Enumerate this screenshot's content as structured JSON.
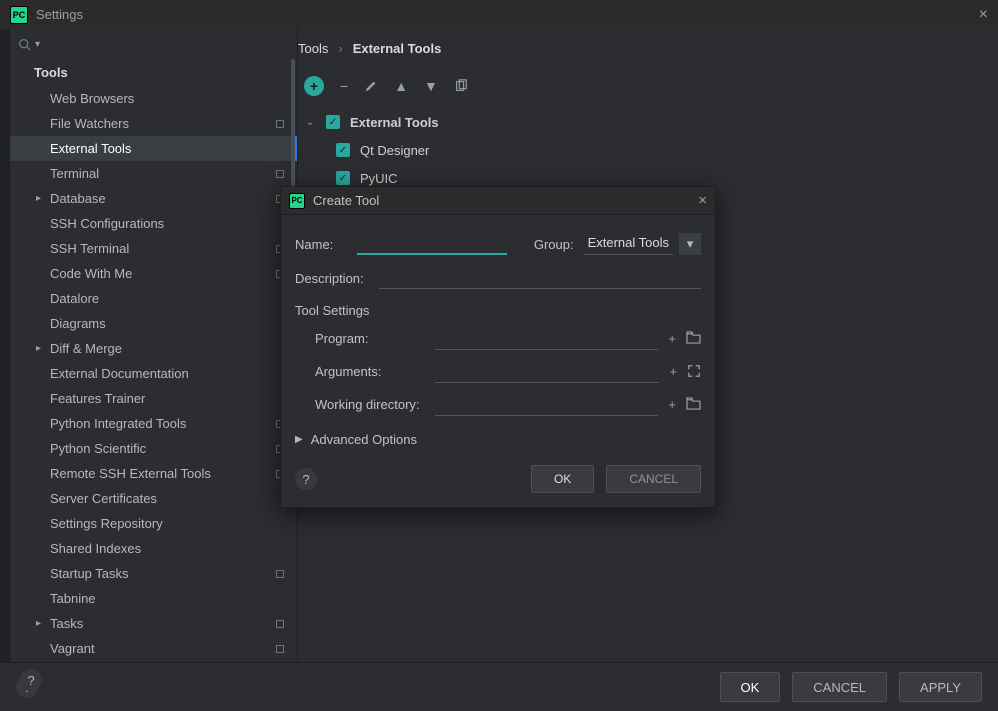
{
  "window": {
    "title": "Settings"
  },
  "search_placeholder": "",
  "sidebar": {
    "header": "Tools",
    "items": [
      {
        "label": "Web Browsers"
      },
      {
        "label": "File Watchers",
        "marker": true
      },
      {
        "label": "External Tools",
        "selected": true
      },
      {
        "label": "Terminal",
        "marker": true
      },
      {
        "label": "Database",
        "chev": true,
        "marker": true
      },
      {
        "label": "SSH Configurations"
      },
      {
        "label": "SSH Terminal",
        "marker": true
      },
      {
        "label": "Code With Me",
        "marker": true
      },
      {
        "label": "Datalore"
      },
      {
        "label": "Diagrams"
      },
      {
        "label": "Diff & Merge",
        "chev": true
      },
      {
        "label": "External Documentation"
      },
      {
        "label": "Features Trainer"
      },
      {
        "label": "Python Integrated Tools",
        "marker": true
      },
      {
        "label": "Python Scientific",
        "marker": true
      },
      {
        "label": "Remote SSH External Tools",
        "marker": true
      },
      {
        "label": "Server Certificates"
      },
      {
        "label": "Settings Repository"
      },
      {
        "label": "Shared Indexes"
      },
      {
        "label": "Startup Tasks",
        "marker": true
      },
      {
        "label": "Tabnine"
      },
      {
        "label": "Tasks",
        "chev": true,
        "marker": true
      },
      {
        "label": "Vagrant",
        "marker": true
      }
    ]
  },
  "breadcrumb": {
    "root": "Tools",
    "sep": "›",
    "leaf": "External Tools"
  },
  "tool_tree": {
    "group": "External Tools",
    "items": [
      "Qt Designer",
      "PyUIC"
    ]
  },
  "modal": {
    "title": "Create Tool",
    "name_label": "Name:",
    "group_label": "Group:",
    "group_value": "External Tools",
    "desc_label": "Description:",
    "section": "Tool Settings",
    "program_label": "Program:",
    "arguments_label": "Arguments:",
    "workdir_label": "Working directory:",
    "advanced": "Advanced Options",
    "ok": "OK",
    "cancel": "CANCEL"
  },
  "buttons": {
    "ok": "OK",
    "cancel": "CANCEL",
    "apply": "APPLY"
  }
}
